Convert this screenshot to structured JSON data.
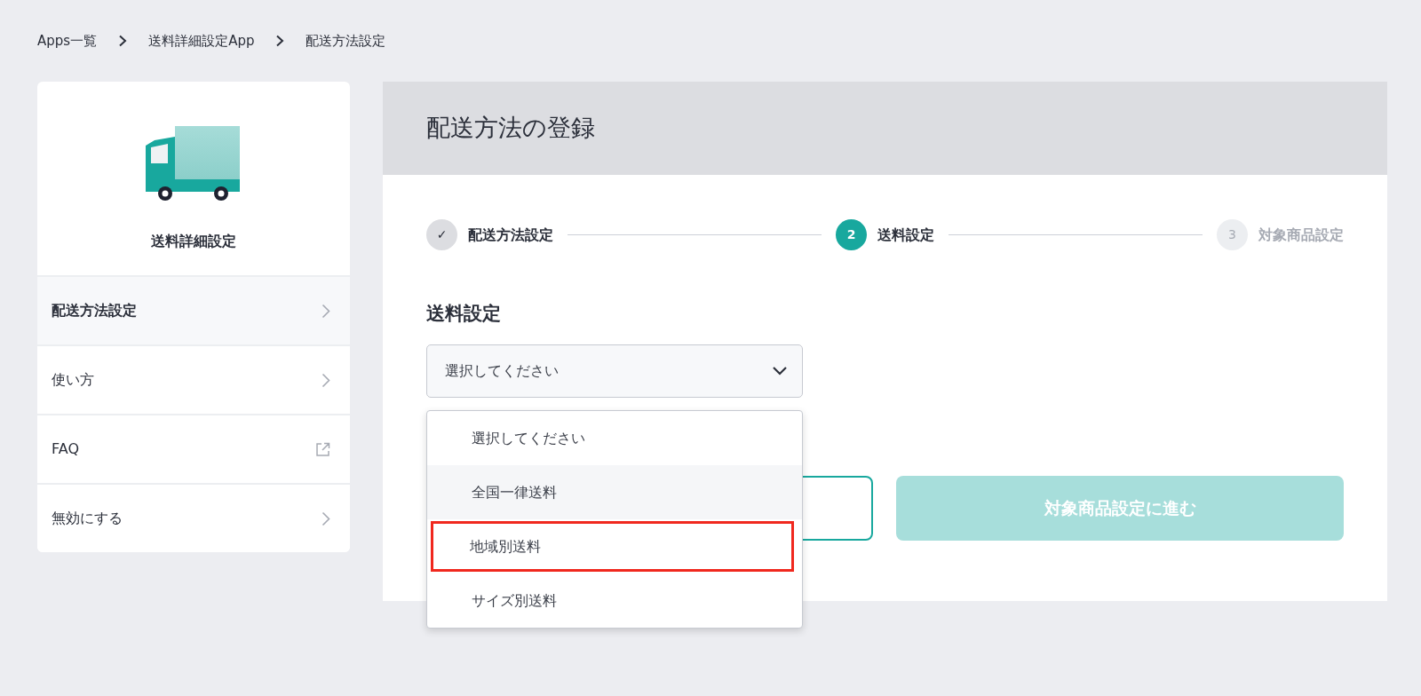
{
  "breadcrumb": [
    {
      "label": "Apps一覧"
    },
    {
      "label": "送料詳細設定App"
    },
    {
      "label": "配送方法設定"
    }
  ],
  "sidebar": {
    "app_name": "送料詳細設定",
    "items": [
      {
        "label": "配送方法設定",
        "kind": "arrow",
        "selected": true
      },
      {
        "label": "使い方",
        "kind": "arrow",
        "selected": false
      },
      {
        "label": "FAQ",
        "kind": "external",
        "selected": false
      },
      {
        "label": "無効にする",
        "kind": "arrow",
        "selected": false
      }
    ]
  },
  "main": {
    "title": "配送方法の登録",
    "steps": [
      {
        "marker": "✓",
        "label": "配送方法設定",
        "done": true,
        "current": false
      },
      {
        "marker": "2",
        "label": "送料設定",
        "done": false,
        "current": true
      },
      {
        "marker": "3",
        "label": "対象商品設定",
        "done": false,
        "current": false
      }
    ],
    "section_title": "送料設定",
    "select": {
      "value": "選択してください",
      "expanded": true
    },
    "options": [
      {
        "label": "選択してください",
        "hovered": false,
        "highlighted": false
      },
      {
        "label": "全国一律送料",
        "hovered": true,
        "highlighted": false
      },
      {
        "label": "地域別送料",
        "hovered": false,
        "highlighted": true
      },
      {
        "label": "サイズ別送料",
        "hovered": false,
        "highlighted": false
      }
    ],
    "buttons": [
      {
        "kind": "outline"
      },
      {
        "kind": "primary",
        "label": "対象商品設定に進む",
        "disabled": true
      }
    ]
  }
}
